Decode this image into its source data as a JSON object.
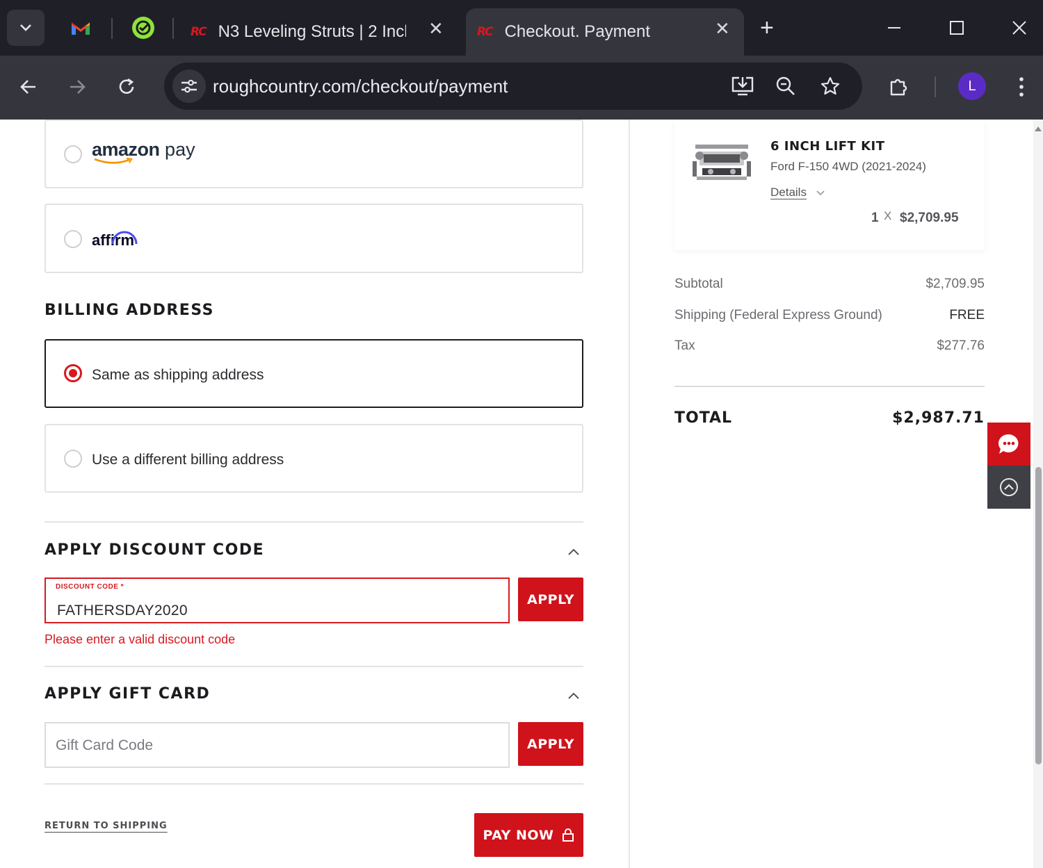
{
  "browser": {
    "tabs": [
      {
        "title": "N3 Leveling Struts | 2 Inch",
        "active": false,
        "icon": "rough-country-logo"
      },
      {
        "title": "Checkout. Payment",
        "active": true,
        "icon": "rough-country-logo"
      }
    ],
    "pinned_tabs": [
      "gmail-icon",
      "grammarly-icon"
    ],
    "tab_logo_text": "RC",
    "url": "roughcountry.com/checkout/payment",
    "profile_initial": "L",
    "colors": {
      "tabstrip": "#1f2027",
      "toolbar": "#35363d",
      "profile": "#5b2bc6"
    }
  },
  "payment": {
    "amazon_pay": {
      "brand": "amazon",
      "suffix": "pay",
      "selected": false
    },
    "affirm": {
      "brand": "affirm",
      "selected": false
    }
  },
  "billing": {
    "title": "BILLING ADDRESS",
    "options": [
      {
        "label": "Same as shipping address",
        "selected": true
      },
      {
        "label": "Use a different billing address",
        "selected": false
      }
    ]
  },
  "discount": {
    "title": "APPLY DISCOUNT CODE",
    "field_label": "DISCOUNT CODE *",
    "value": "FATHERSDAY2020",
    "apply_label": "APPLY",
    "error": "Please enter a valid discount code"
  },
  "gift_card": {
    "title": "APPLY GIFT CARD",
    "placeholder": "Gift Card Code",
    "apply_label": "APPLY"
  },
  "footer": {
    "return_label": "RETURN TO SHIPPING",
    "pay_now_label": "PAY NOW"
  },
  "summary": {
    "product": {
      "name": "6 INCH LIFT KIT",
      "fitment": "Ford F-150 4WD (2021-2024)",
      "details_label": "Details",
      "quantity": "1",
      "times": "X",
      "price": "$2,709.95"
    },
    "rows": [
      {
        "label": "Subtotal",
        "value": "$2,709.95"
      },
      {
        "label": "Shipping (Federal Express Ground)",
        "value": "FREE"
      },
      {
        "label": "Tax",
        "value": "$277.76"
      }
    ],
    "total_label": "TOTAL",
    "total_value": "$2,987.71"
  },
  "accent_color": "#d0121b"
}
